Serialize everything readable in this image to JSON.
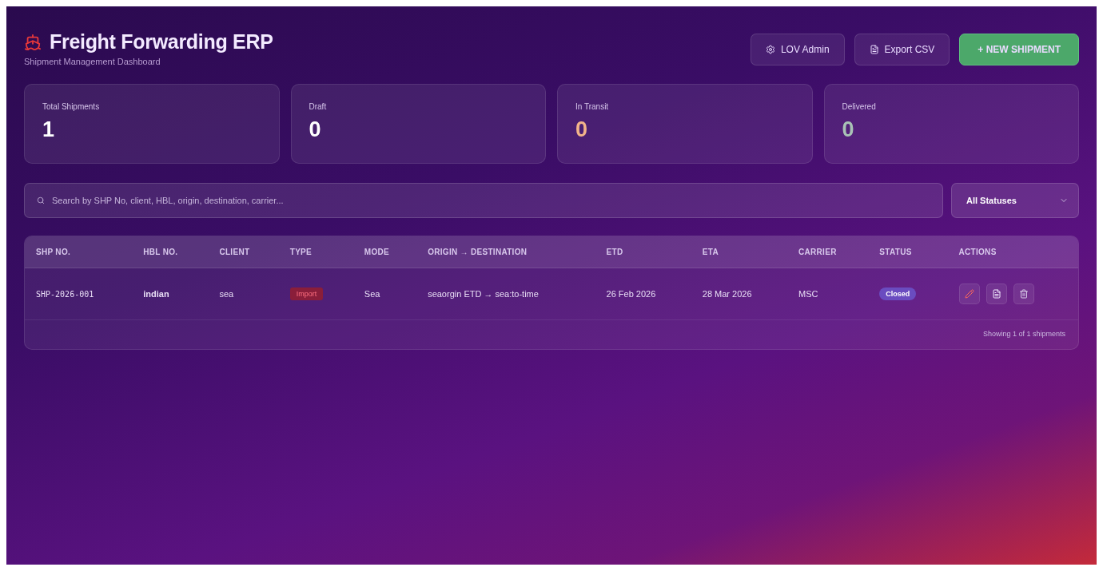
{
  "header": {
    "title": "Freight Forwarding ERP",
    "subtitle": "Shipment Management Dashboard"
  },
  "actions": [
    {
      "kind": "gear",
      "label": "LOV Admin"
    },
    {
      "kind": "file",
      "label": "Export CSV"
    },
    {
      "kind": "primary",
      "label": "+ NEW SHIPMENT"
    }
  ],
  "stats": [
    {
      "label": "Total Shipments",
      "value": "1",
      "color": "#ffffff"
    },
    {
      "label": "Draft",
      "value": "0",
      "color": "#ffffff"
    },
    {
      "label": "In Transit",
      "value": "0",
      "color": "#f2b48a"
    },
    {
      "label": "Delivered",
      "value": "0",
      "color": "#a9c2b6"
    }
  ],
  "search": {
    "placeholder": "Search by SHP No, client, HBL, origin, destination, carrier..."
  },
  "status_filter": {
    "value": "All Statuses"
  },
  "table": {
    "columns": [
      "SHP NO.",
      "HBL NO.",
      "CLIENT",
      "TYPE",
      "MODE",
      "ORIGIN → DESTINATION",
      "ETD",
      "ETA",
      "CARRIER",
      "STATUS",
      "ACTIONS"
    ],
    "rows": [
      {
        "shp_no": "SHP-2026-001",
        "hbl_no": "indian",
        "client": "sea",
        "type": "Import",
        "mode": "Sea",
        "route": "seaorgin ETD → sea:to-time",
        "etd": "26 Feb 2026",
        "eta": "28 Mar 2026",
        "carrier": "MSC",
        "status": "Closed"
      }
    ],
    "footer": "Showing 1 of 1 shipments"
  }
}
